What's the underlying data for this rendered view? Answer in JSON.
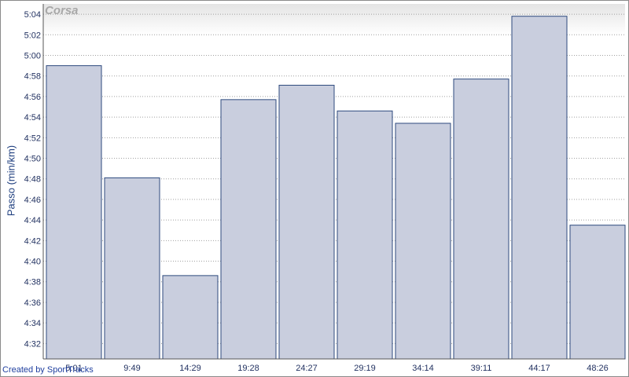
{
  "chart_data": {
    "type": "bar",
    "title": "Corsa",
    "ylabel": "Passo (min/km)",
    "xlabel": "",
    "categories": [
      "5:01",
      "9:49",
      "14:29",
      "19:28",
      "24:27",
      "29:19",
      "34:14",
      "39:11",
      "44:17",
      "48:26"
    ],
    "values_seconds": [
      299,
      288.1,
      278.6,
      295.7,
      297.1,
      294.6,
      293.4,
      297.7,
      303.8,
      283.5
    ],
    "value_labels_note_free": "pace in seconds per km",
    "ylim_seconds": [
      270.5,
      305
    ],
    "y_ticks": [
      "4:32",
      "4:34",
      "4:36",
      "4:38",
      "4:40",
      "4:42",
      "4:44",
      "4:46",
      "4:48",
      "4:50",
      "4:52",
      "4:54",
      "4:56",
      "4:58",
      "5:00",
      "5:02",
      "5:04"
    ],
    "grid": true,
    "colors": {
      "bar": "#c9cede",
      "bar_edge": "#2e4a7e",
      "grid": "#a0a0a0",
      "axis_text": "#1f2f5f"
    }
  },
  "footer": {
    "credit": "Created by SportTracks"
  }
}
